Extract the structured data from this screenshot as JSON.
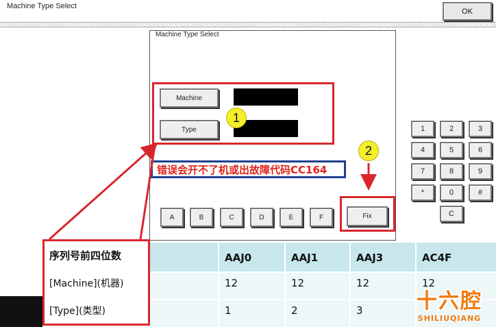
{
  "window": {
    "title": "Machine Type Select",
    "ok_label": "OK"
  },
  "dialog": {
    "title": "Machine Type Select",
    "machine_label": "Machine",
    "type_label": "Type",
    "letters": [
      "A",
      "B",
      "C",
      "D",
      "E",
      "F"
    ],
    "fix_label": "Fix"
  },
  "keypad": {
    "row1": [
      "1",
      "2",
      "3"
    ],
    "row2": [
      "4",
      "5",
      "6"
    ],
    "row3": [
      "7",
      "8",
      "9"
    ],
    "row4": [
      "*",
      "0",
      "#"
    ],
    "row5": [
      "C"
    ]
  },
  "annotations": {
    "marker1": "1",
    "marker2": "2",
    "error_note": "错误会开不了机或出故障代码CC164",
    "colors": {
      "red": "#d9262c",
      "blue": "#1d3f8e",
      "yellow": "#f5ef2a"
    }
  },
  "table": {
    "header_label": "序列号前四位数",
    "columns": [
      "AAJ0",
      "AAJ1",
      "AAJ3",
      "AC4F"
    ],
    "rows": [
      {
        "label": "[Machine](机器)",
        "values": [
          "12",
          "12",
          "12",
          "12"
        ]
      },
      {
        "label": "[Type](类型)",
        "values": [
          "1",
          "2",
          "3",
          ""
        ]
      }
    ]
  },
  "logo": {
    "main": "十六腔",
    "sub": "SHILIUQIANG"
  }
}
